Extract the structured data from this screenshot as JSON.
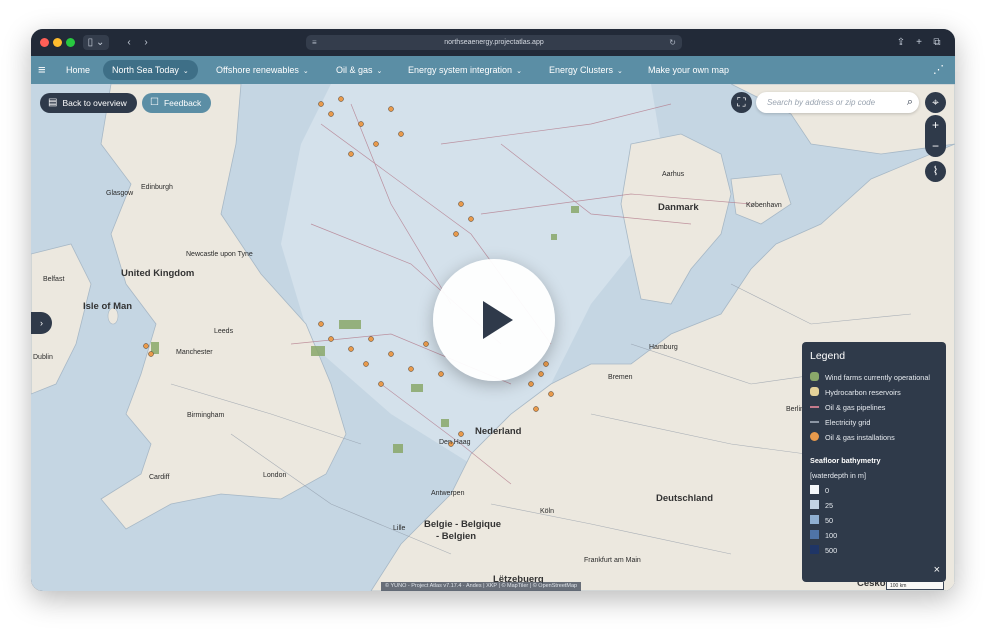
{
  "browser": {
    "url": "northseaenergy.projectatlas.app",
    "sidebar_icon": "sidebar-icon",
    "back_icon": "chevron-left-icon",
    "forward_icon": "chevron-right-icon"
  },
  "nav": {
    "menu_icon": "hamburger-icon",
    "items": [
      {
        "label": "Home"
      },
      {
        "label": "North Sea Today",
        "chevron": "⌄"
      },
      {
        "label": "Offshore renewables",
        "chevron": "⌄"
      },
      {
        "label": "Oil & gas",
        "chevron": "⌄"
      },
      {
        "label": "Energy system integration",
        "chevron": "⌄"
      },
      {
        "label": "Energy Clusters",
        "chevron": "⌄"
      },
      {
        "label": "Make your own map"
      }
    ],
    "share_icon": "share-icon"
  },
  "map": {
    "back_button": "Back to overview",
    "feedback_button": "Feedback",
    "search_placeholder": "Search by address or zip code",
    "attribution": "© YUNO - Project Atlas v7.17.4 · Andes | XKP | © MapTiler | © OpenStreetMap",
    "scale_label": "100 km",
    "labels": {
      "glasgow": "Glasgow",
      "edinburgh": "Edinburgh",
      "newcastle": "Newcastle upon Tyne",
      "uk": "United Kingdom",
      "belfast": "Belfast",
      "isle_of_man": "Isle of Man",
      "dublin": "Dublin",
      "leeds": "Leeds",
      "manchester": "Manchester",
      "birmingham": "Birmingham",
      "cardiff": "Cardiff",
      "london": "London",
      "aarhus": "Aarhus",
      "danmark": "Danmark",
      "kobenhavn": "København",
      "hamburg": "Hamburg",
      "bremen": "Bremen",
      "berlin": "Berlin",
      "nederland": "Nederland",
      "haag": "Den Haag",
      "antwerpen": "Antwerpen",
      "lille": "Lille",
      "belgie": "Belgie - Belgique",
      "belgien": "- Belgien",
      "koln": "Köln",
      "deutschland": "Deutschland",
      "frankfurt": "Frankfurt am Main",
      "letzebuerg": "Lëtzebuerg",
      "cesko": "Česko"
    }
  },
  "legend": {
    "title": "Legend",
    "items": [
      {
        "label": "Wind farms currently operational",
        "color": "#8aa86a"
      },
      {
        "label": "Hydrocarbon reservoirs",
        "color": "#e3d29a"
      },
      {
        "label": "Oil & gas pipelines",
        "color": "#c47a8c"
      },
      {
        "label": "Electricity grid",
        "color": "#8c96a4"
      },
      {
        "label": "Oil & gas installations",
        "color": "#e89a4c"
      }
    ],
    "bathymetry_title": "Seafloor bathymetry",
    "bathymetry_unit": "[waterdepth in m]",
    "depths": [
      {
        "label": "0",
        "color": "#f4f7fa"
      },
      {
        "label": "25",
        "color": "#c3d3e4"
      },
      {
        "label": "50",
        "color": "#8fafd1"
      },
      {
        "label": "100",
        "color": "#4f74a8"
      },
      {
        "label": "500",
        "color": "#1f3566"
      }
    ],
    "close_icon": "close-icon"
  }
}
